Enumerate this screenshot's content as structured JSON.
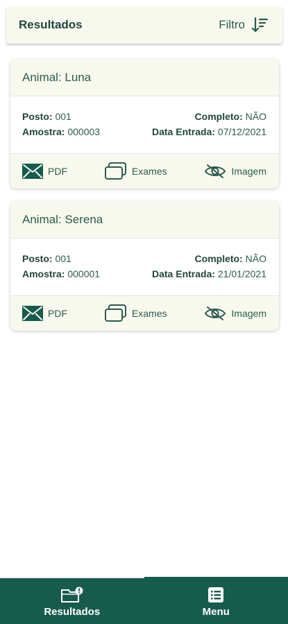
{
  "header": {
    "title": "Resultados",
    "filter_label": "Filtro"
  },
  "labels": {
    "posto": "Posto:",
    "amostra": "Amostra:",
    "completo": "Completo:",
    "data_entrada": "Data Entrada:"
  },
  "cards": [
    {
      "animal": "Animal: Luna",
      "posto": "001",
      "amostra": "000003",
      "completo": "NÃO",
      "data_entrada": "07/12/2021",
      "actions": {
        "pdf": "PDF",
        "exames": "Exames",
        "imagem": "Imagem"
      }
    },
    {
      "animal": "Animal: Serena",
      "posto": "001",
      "amostra": "000001",
      "completo": "NÃO",
      "data_entrada": "21/01/2021",
      "actions": {
        "pdf": "PDF",
        "exames": "Exames",
        "imagem": "Imagem"
      }
    }
  ],
  "bottom_nav": {
    "items": [
      {
        "label": "Resultados",
        "icon": "results-icon",
        "active": true
      },
      {
        "label": "Menu",
        "icon": "menu-list-icon",
        "active": false
      }
    ]
  },
  "colors": {
    "primary": "#175b4d",
    "text": "#2d5a4f",
    "card_tint": "#f8f9ee"
  }
}
